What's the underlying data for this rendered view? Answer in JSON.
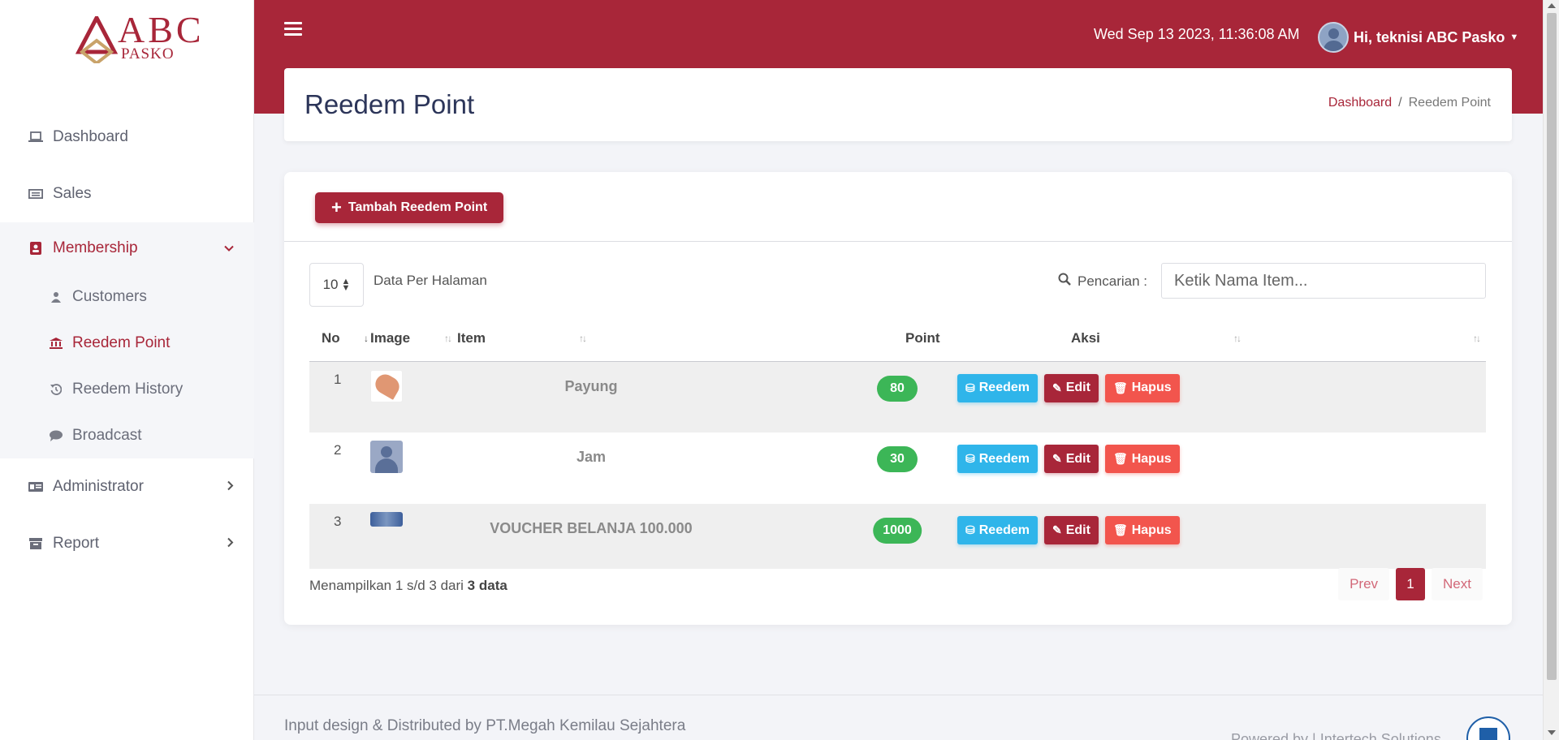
{
  "brand": {
    "logo_text": "ABC",
    "logo_sub": "PASKO",
    "accent": "#a82639"
  },
  "sidebar": {
    "items": [
      {
        "label": "Dashboard",
        "icon": "laptop-icon"
      },
      {
        "label": "Sales",
        "icon": "list-icon"
      },
      {
        "label": "Membership",
        "icon": "address-book-icon",
        "open": true,
        "children": [
          {
            "label": "Customers",
            "icon": "users-icon"
          },
          {
            "label": "Reedem Point",
            "icon": "bank-icon",
            "active": true
          },
          {
            "label": "Reedem History",
            "icon": "history-icon"
          },
          {
            "label": "Broadcast",
            "icon": "comment-icon"
          }
        ]
      },
      {
        "label": "Administrator",
        "icon": "id-card-icon"
      },
      {
        "label": "Report",
        "icon": "archive-icon"
      }
    ]
  },
  "topbar": {
    "datetime": "Wed Sep 13 2023, 11:36:08 AM",
    "user_greeting": "Hi, teknisi ABC Pasko"
  },
  "page": {
    "title": "Reedem Point",
    "breadcrumb": {
      "home": "Dashboard",
      "separator": "/",
      "current": "Reedem Point"
    }
  },
  "toolbar": {
    "add_label": "Tambah Reedem Point",
    "per_page_value": "10",
    "per_page_label": "Data Per Halaman",
    "search_label": "Pencarian :",
    "search_placeholder": "Ketik Nama Item..."
  },
  "table": {
    "columns": [
      "No",
      "Image",
      "Item",
      "Point",
      "Aksi"
    ],
    "rows": [
      {
        "no": "1",
        "image": "umbrella",
        "item": "Payung",
        "point": "80"
      },
      {
        "no": "2",
        "image": "placeholder-person",
        "item": "Jam",
        "point": "30"
      },
      {
        "no": "3",
        "image": "voucher",
        "item": "VOUCHER BELANJA 100.000",
        "point": "1000"
      }
    ],
    "action_labels": {
      "reedem": "Reedem",
      "edit": "Edit",
      "hapus": "Hapus"
    }
  },
  "summary": {
    "prefix": "Menampilkan 1 s/d 3 dari",
    "total": "3 data"
  },
  "pagination": {
    "prev": "Prev",
    "current": "1",
    "next": "Next"
  },
  "footer": {
    "text": "Input design & Distributed by PT.Megah Kemilau Sejahtera",
    "powered": "Powered by | Intertech Solutions"
  }
}
